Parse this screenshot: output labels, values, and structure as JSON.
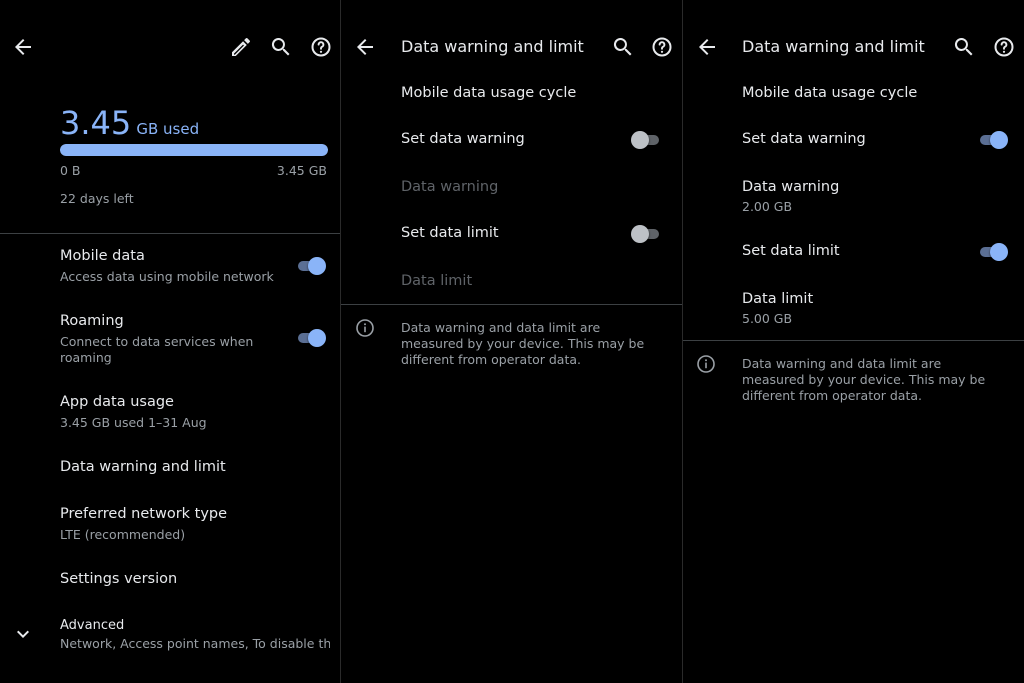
{
  "panel1": {
    "usage": {
      "amount": "3.45",
      "unit": "GB used",
      "progress_fraction": 1.0,
      "range_min": "0 B",
      "range_max": "3.45 GB",
      "days_left": "22 days left"
    },
    "items": [
      {
        "title": "Mobile data",
        "subtitle": "Access data using mobile network",
        "toggle": "on"
      },
      {
        "title": "Roaming",
        "subtitle": "Connect to data services when roaming",
        "toggle": "on"
      },
      {
        "title": "App data usage",
        "subtitle": "3.45 GB used 1–31 Aug"
      },
      {
        "title": "Data warning and limit"
      },
      {
        "title": "Preferred network type",
        "subtitle": "LTE (recommended)"
      },
      {
        "title": "Settings version"
      },
      {
        "title": "Advanced",
        "subtitle": "Network, Access point names, To disable thi…"
      }
    ],
    "icons": [
      "back-arrow-icon",
      "edit-pencil-icon",
      "search-icon",
      "help-icon",
      "chevron-down-icon"
    ]
  },
  "panel2": {
    "title": "Data warning and limit",
    "items": [
      {
        "title": "Mobile data usage cycle"
      },
      {
        "title": "Set data warning",
        "toggle": "off"
      },
      {
        "title": "Data warning",
        "disabled": true
      },
      {
        "title": "Set data limit",
        "toggle": "off"
      },
      {
        "title": "Data limit",
        "disabled": true
      }
    ],
    "note": "Data warning and data limit are measured by your device. This may be different from operator data."
  },
  "panel3": {
    "title": "Data warning and limit",
    "items": [
      {
        "title": "Mobile data usage cycle"
      },
      {
        "title": "Set data warning",
        "toggle": "on"
      },
      {
        "title": "Data warning",
        "subtitle": "2.00 GB"
      },
      {
        "title": "Set data limit",
        "toggle": "on"
      },
      {
        "title": "Data limit",
        "subtitle": "5.00 GB"
      }
    ],
    "note": "Data warning and data limit are measured by your device. This may be different from operator data."
  },
  "colors": {
    "accent": "#8ab4f8",
    "background": "#000000",
    "text_primary": "#e8eaed",
    "text_secondary": "#9aa0a6",
    "text_disabled": "#5f6368"
  }
}
